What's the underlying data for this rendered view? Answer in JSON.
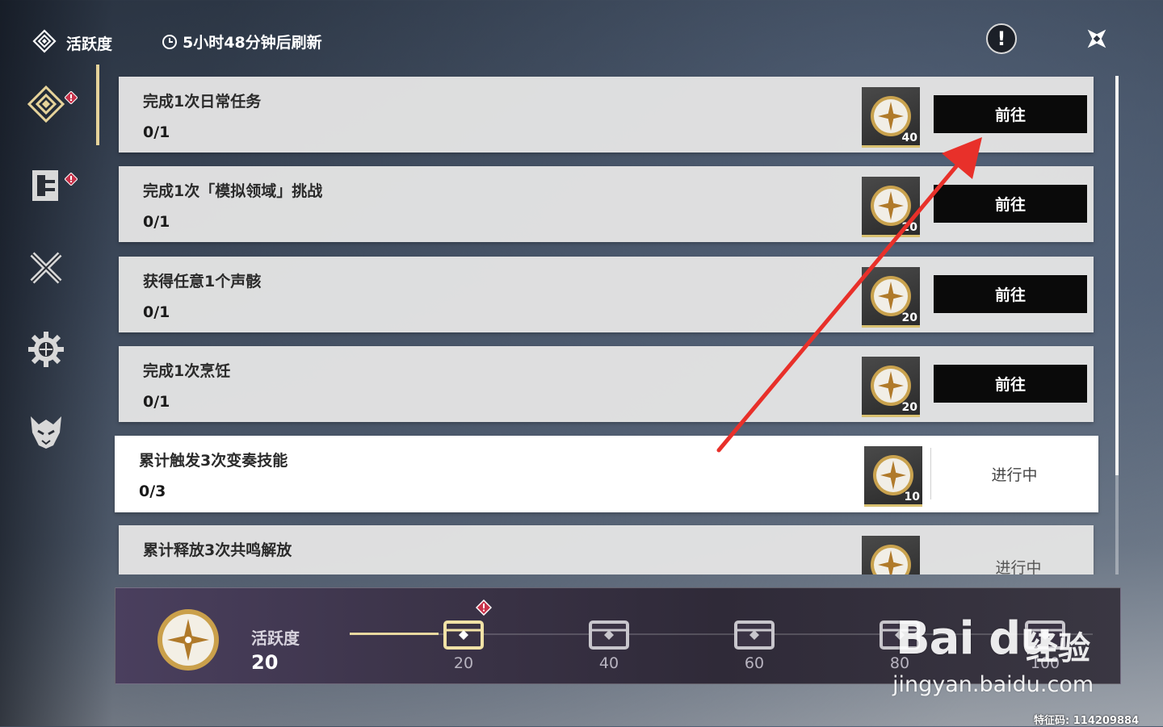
{
  "header": {
    "title": "活跃度",
    "refresh_timer": "5小时48分钟后刷新",
    "info_icon": "info-icon",
    "close_icon": "close-icon"
  },
  "sidebar": {
    "items": [
      {
        "icon": "activity-diamond-icon",
        "selected": true,
        "badge": true
      },
      {
        "icon": "task-board-icon",
        "selected": false,
        "badge": true
      },
      {
        "icon": "crossed-swords-icon",
        "selected": false,
        "badge": false
      },
      {
        "icon": "gear-snowflake-icon",
        "selected": false,
        "badge": false
      },
      {
        "icon": "demon-mask-icon",
        "selected": false,
        "badge": false
      }
    ]
  },
  "quests": [
    {
      "title": "完成1次日常任务",
      "progress": "0/1",
      "reward": "40",
      "action": "前往",
      "status": ""
    },
    {
      "title": "完成1次「模拟领域」挑战",
      "progress": "0/1",
      "reward": "20",
      "action": "前往",
      "status": ""
    },
    {
      "title": "获得任意1个声骸",
      "progress": "0/1",
      "reward": "20",
      "action": "前往",
      "status": ""
    },
    {
      "title": "完成1次烹饪",
      "progress": "0/1",
      "reward": "20",
      "action": "前往",
      "status": ""
    },
    {
      "title": "累计触发3次变奏技能",
      "progress": "0/3",
      "reward": "10",
      "action": "",
      "status": "进行中"
    },
    {
      "title": "累计释放3次共鸣解放",
      "progress": "",
      "reward": "",
      "action": "",
      "status": "进行中"
    }
  ],
  "activity_bar": {
    "label": "活跃度",
    "value": "20",
    "milestones": [
      "20",
      "40",
      "60",
      "80",
      "100"
    ],
    "progress_fraction": 0.2
  },
  "watermark": {
    "brand": "Bai du",
    "brand_cn": "经验",
    "url": "jingyan.baidu.com",
    "feature_code": "特征码: 114209884"
  },
  "colors": {
    "accent_gold": "#e6d39a",
    "badge_red": "#c8324a",
    "button_black": "#0a0a0a",
    "arrow_red": "#e8302a"
  }
}
